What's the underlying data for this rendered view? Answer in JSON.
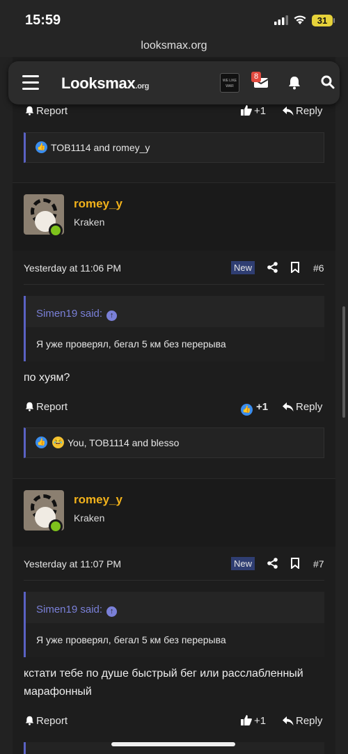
{
  "status": {
    "time": "15:59",
    "battery": "31"
  },
  "browser": {
    "url": "looksmax.org"
  },
  "nav": {
    "logo_main": "Lo",
    "logo_mid": "o",
    "logo_rest": "ksmax",
    "logo_org": ".org",
    "inbox_count": "8",
    "avatar_text": "WE LIKE WAR"
  },
  "actions": {
    "report": "Report",
    "plus_one": "+1",
    "reply": "Reply"
  },
  "posts": [
    {
      "reactions": "TOB1114 and romey_y"
    },
    {
      "username": "romey_y",
      "user_title": "Kraken",
      "date": "Yesterday at 11:06 PM",
      "badge": "New",
      "number": "#6",
      "quote_author": "Simen19 said:",
      "quote_text": "Я уже проверял, бегал 5 км без перерыва",
      "message": "по хуям?",
      "reactions": "You, TOB1114 and blesso"
    },
    {
      "username": "romey_y",
      "user_title": "Kraken",
      "date": "Yesterday at 11:07 PM",
      "badge": "New",
      "number": "#7",
      "quote_author": "Simen19 said:",
      "quote_text": "Я уже проверял, бегал 5 км без перерыва",
      "message": "кстати тебе по душе быстрый бег или расслабленный марафонный"
    }
  ]
}
